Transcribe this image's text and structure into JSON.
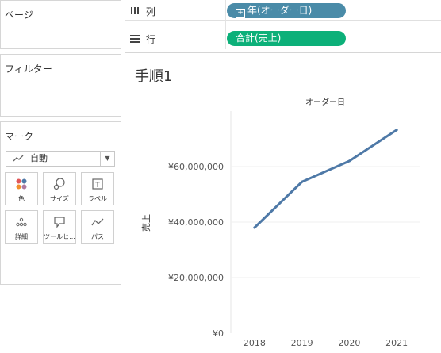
{
  "panels": {
    "pages": {
      "title": "ページ"
    },
    "filters": {
      "title": "フィルター"
    },
    "marks": {
      "title": "マーク",
      "mark_type": {
        "value": "自動",
        "icon": "line-icon"
      },
      "buttons": [
        {
          "label": "色",
          "icon": "color-icon"
        },
        {
          "label": "サイズ",
          "icon": "size-icon"
        },
        {
          "label": "ラベル",
          "icon": "label-icon"
        },
        {
          "label": "詳細",
          "icon": "detail-icon"
        },
        {
          "label": "ツールヒ...",
          "icon": "tooltip-icon"
        },
        {
          "label": "パス",
          "icon": "path-icon"
        }
      ]
    }
  },
  "shelves": {
    "columns": {
      "label": "列",
      "pill": "年(オーダー日)",
      "pill_color": "#4a8ba8"
    },
    "rows": {
      "label": "行",
      "pill": "合計(売上)",
      "pill_color": "#0cb079"
    }
  },
  "sheet": {
    "title": "手順1"
  },
  "chart_data": {
    "type": "line",
    "title": "オーダー日",
    "xlabel": "",
    "ylabel": "売上",
    "categories": [
      "2018",
      "2019",
      "2020",
      "2021"
    ],
    "series": [
      {
        "values": [
          38000000,
          54500000,
          62000000,
          73200000
        ],
        "color": "#4e79a7"
      }
    ],
    "ylim": [
      0,
      80000000
    ],
    "yticks": [
      0,
      20000000,
      40000000,
      60000000
    ],
    "ytick_labels": [
      "¥0",
      "¥20,000,000",
      "¥40,000,000",
      "¥60,000,000"
    ],
    "grid": true
  }
}
